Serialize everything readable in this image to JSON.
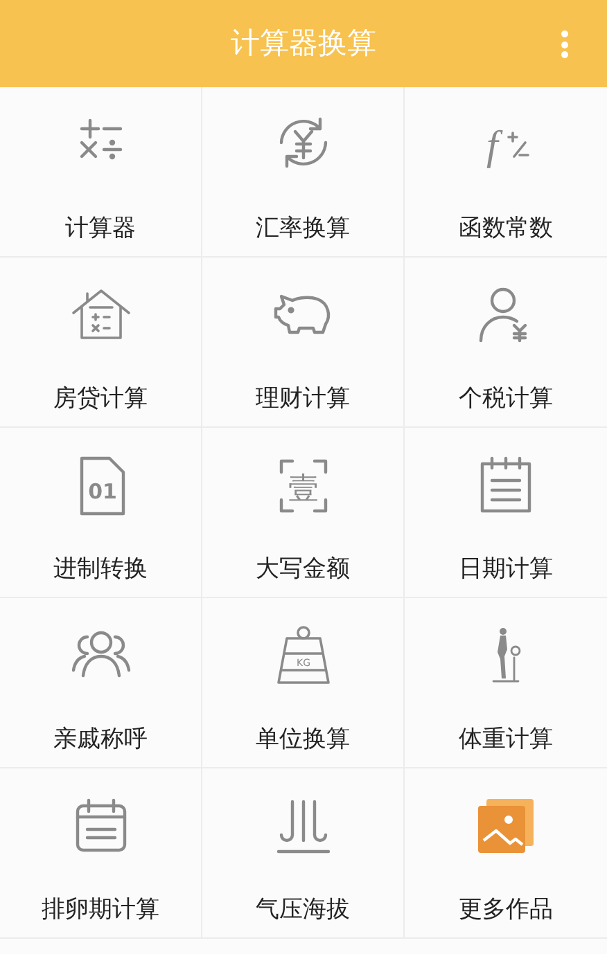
{
  "header": {
    "title": "计算器换算"
  },
  "items": [
    {
      "label": "计算器",
      "kind": "calculator"
    },
    {
      "label": "汇率换算",
      "kind": "exchange"
    },
    {
      "label": "函数常数",
      "kind": "function",
      "icon_text": "f"
    },
    {
      "label": "房贷计算",
      "kind": "house"
    },
    {
      "label": "理财计算",
      "kind": "piggy"
    },
    {
      "label": "个税计算",
      "kind": "tax"
    },
    {
      "label": "进制转换",
      "kind": "file",
      "icon_text": "01"
    },
    {
      "label": "大写金额",
      "kind": "scan",
      "icon_text": "壹"
    },
    {
      "label": "日期计算",
      "kind": "notepad"
    },
    {
      "label": "亲戚称呼",
      "kind": "people"
    },
    {
      "label": "单位换算",
      "kind": "weight",
      "icon_text": "KG"
    },
    {
      "label": "体重计算",
      "kind": "scale"
    },
    {
      "label": "排卵期计算",
      "kind": "calendar"
    },
    {
      "label": "气压海拔",
      "kind": "pressure"
    },
    {
      "label": "更多作品",
      "kind": "gallery"
    }
  ]
}
